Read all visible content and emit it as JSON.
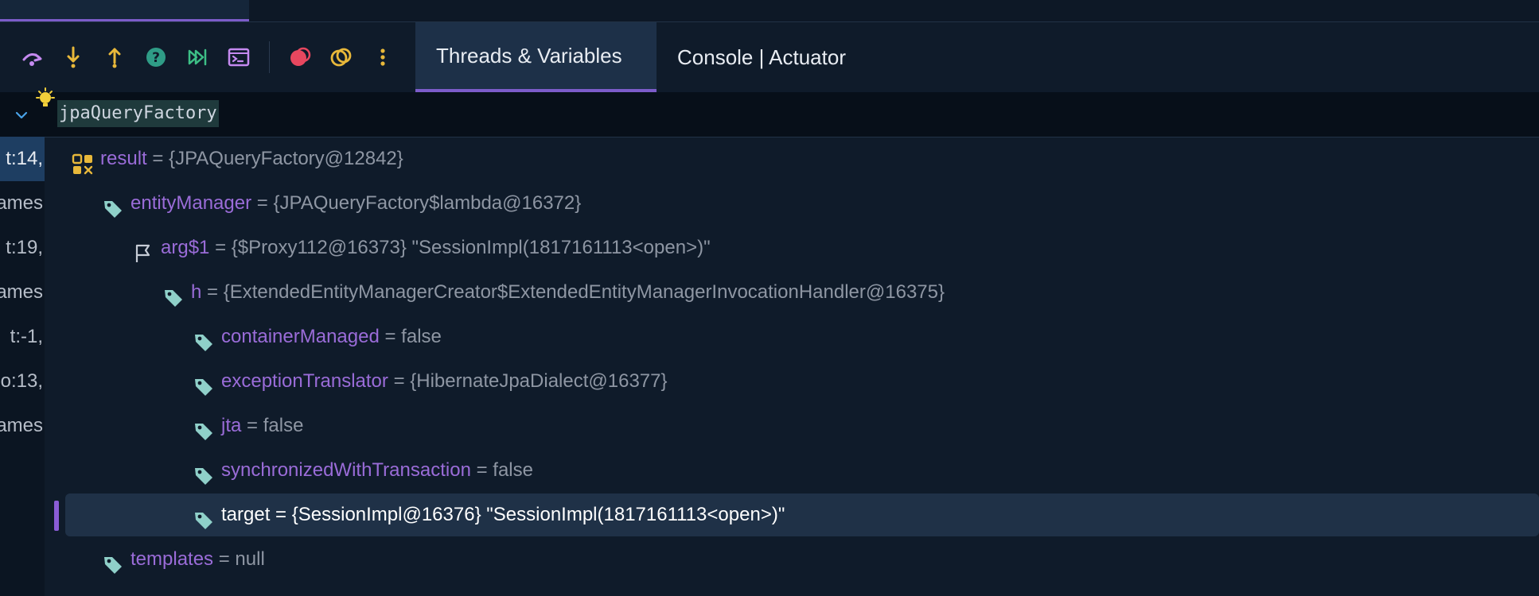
{
  "tabs": [
    {
      "label": "Threads & Variables",
      "active": true
    },
    {
      "label": "Console | Actuator",
      "active": false
    }
  ],
  "toolbar": {
    "icons": [
      "step-over-icon",
      "step-into-icon",
      "step-out-icon",
      "help-icon",
      "run-to-cursor-icon",
      "evaluate-expression-icon",
      "breakpoint-icon",
      "mute-breakpoints-icon",
      "more-icon"
    ]
  },
  "evaluate": {
    "expression": "jpaQueryFactory"
  },
  "frames": [
    {
      "label": "t:14,",
      "selected": true
    },
    {
      "label": "ames",
      "selected": false
    },
    {
      "label": "t:19,",
      "selected": false
    },
    {
      "label": "ames",
      "selected": false
    },
    {
      "label": "t:-1,",
      "selected": false
    },
    {
      "label": "o:13,",
      "selected": false
    },
    {
      "label": "ames",
      "selected": false
    }
  ],
  "variables": [
    {
      "name": "result",
      "eq": "=",
      "value": "{JPAQueryFactory@12842}",
      "icon": "grid-icon",
      "depth": 0
    },
    {
      "name": "entityManager",
      "eq": "=",
      "value": "{JPAQueryFactory$lambda@16372}",
      "icon": "tag-icon",
      "depth": 1
    },
    {
      "name": "arg$1",
      "eq": "=",
      "value": "{$Proxy112@16373} \"SessionImpl(1817161113<open>)\"",
      "icon": "flag-icon",
      "depth": 2
    },
    {
      "name": "h",
      "eq": "=",
      "value": "{ExtendedEntityManagerCreator$ExtendedEntityManagerInvocationHandler@16375}",
      "icon": "tag-icon",
      "depth": 3
    },
    {
      "name": "containerManaged",
      "eq": "=",
      "value": "false",
      "icon": "tag-icon",
      "depth": 4
    },
    {
      "name": "exceptionTranslator",
      "eq": "=",
      "value": "{HibernateJpaDialect@16377}",
      "icon": "tag-icon",
      "depth": 4
    },
    {
      "name": "jta",
      "eq": "=",
      "value": "false",
      "icon": "tag-icon",
      "depth": 4
    },
    {
      "name": "synchronizedWithTransaction",
      "eq": "=",
      "value": "false",
      "icon": "tag-icon",
      "depth": 4
    },
    {
      "name": "target",
      "eq": "=",
      "value": "{SessionImpl@16376} \"SessionImpl(1817161113<open>)\"",
      "icon": "tag-icon",
      "depth": 4,
      "selected": true
    },
    {
      "name": "templates",
      "eq": "=",
      "value": "null",
      "icon": "tag-icon",
      "depth": 1
    }
  ],
  "colors": {
    "accent": "#7c5cc9",
    "name": "#9a6cd8",
    "value": "#8e96a3",
    "background": "#0f1b2a"
  }
}
